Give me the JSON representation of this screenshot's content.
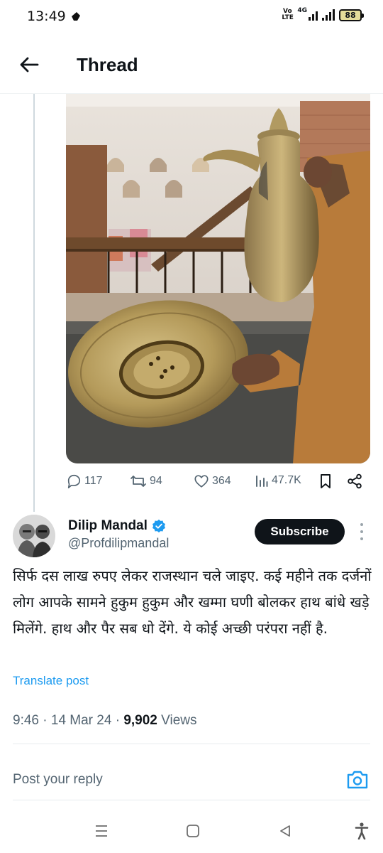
{
  "status_bar": {
    "time": "13:49",
    "volte": "Vo LTE",
    "network": "4G",
    "battery": "88"
  },
  "header": {
    "title": "Thread",
    "back_icon": "arrow-left-icon"
  },
  "parent_tweet_actions": {
    "replies": "117",
    "reposts": "94",
    "likes": "364",
    "views": "47.7K"
  },
  "tweet": {
    "author_name": "Dilip Mandal",
    "author_handle": "@Profdilipmandal",
    "verified": true,
    "subscribe_label": "Subscribe",
    "text": "सिर्फ दस लाख रुपए लेकर राजस्थान चले जाइए. कई महीने तक दर्जनों लोग आपके सामने हुकुम हुकुम और खम्मा घणी बोलकर हाथ बांधे खड़े मिलेंगे. हाथ और पैर सब धो देंगे. ये कोई अच्छी परंपरा नहीं है.",
    "translate_label": "Translate post",
    "time": "9:46",
    "date": "14 Mar 24",
    "views_count": "9,902",
    "views_label": "Views"
  },
  "reply": {
    "placeholder": "Post your reply"
  },
  "colors": {
    "accent": "#1d9bf0",
    "text_primary": "#0f1419",
    "text_secondary": "#536471",
    "subscribe_bg": "#0f1419"
  }
}
